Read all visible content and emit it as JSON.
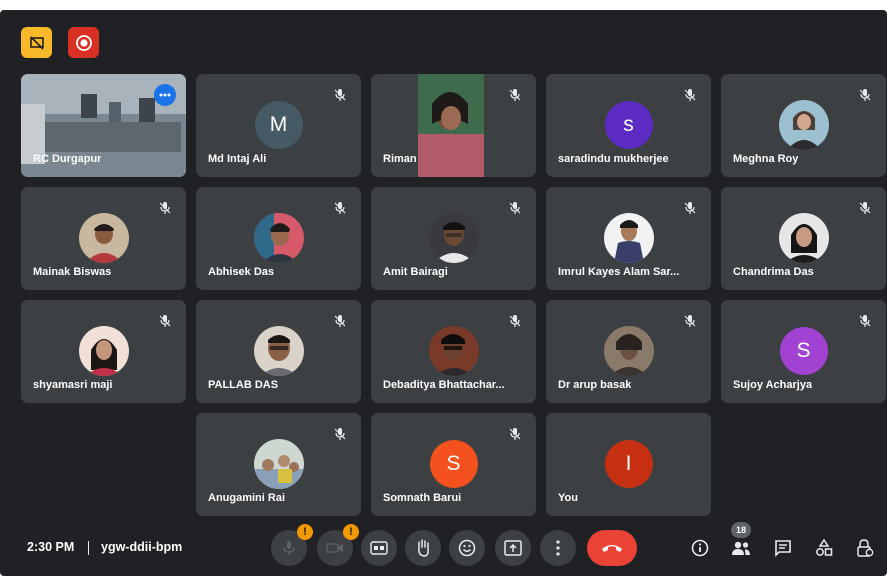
{
  "top_icons": [
    {
      "name": "presentation-off-icon",
      "color": "#f7b928"
    },
    {
      "name": "record-icon",
      "color": "#d93025"
    }
  ],
  "participants": [
    {
      "name": "RC Durgapur",
      "tile": "video",
      "selected": true
    },
    {
      "name": "Md Intaj Ali",
      "tile": "initial",
      "initial": "M",
      "color": "#455a64"
    },
    {
      "name": "Riman",
      "tile": "video"
    },
    {
      "name": "saradindu mukherjee",
      "tile": "initial",
      "initial": "s",
      "color": "#5b2bc4"
    },
    {
      "name": "Meghna Roy",
      "tile": "photo"
    },
    {
      "name": "Mainak Biswas",
      "tile": "photo"
    },
    {
      "name": "Abhisek Das",
      "tile": "photo"
    },
    {
      "name": "Amit Bairagi",
      "tile": "photo"
    },
    {
      "name": "Imrul Kayes Alam Sar...",
      "tile": "photo"
    },
    {
      "name": "Chandrima Das",
      "tile": "photo"
    },
    {
      "name": "shyamasri maji",
      "tile": "photo"
    },
    {
      "name": "PALLAB DAS",
      "tile": "photo"
    },
    {
      "name": "Debaditya Bhattachar...",
      "tile": "photo"
    },
    {
      "name": "Dr arup basak",
      "tile": "photo"
    },
    {
      "name": "Sujoy Acharjya",
      "tile": "initial",
      "initial": "S",
      "color": "#a142d2"
    },
    {
      "name": "Anugamini Rai",
      "tile": "photo"
    },
    {
      "name": "Somnath Barui",
      "tile": "initial",
      "initial": "S",
      "color": "#f4511e"
    },
    {
      "name": "You",
      "tile": "initial",
      "initial": "I",
      "color": "#c62f12"
    }
  ],
  "bottom_bar": {
    "time": "2:30 PM",
    "meeting_code": "ygw-ddii-bpm",
    "warning_mark": "!",
    "people_count": "18",
    "controls": [
      "microphone-icon",
      "camera-icon",
      "captions-icon",
      "raise-hand-icon",
      "emoji-icon",
      "present-screen-icon",
      "more-options-icon",
      "end-call-icon"
    ],
    "right_controls": [
      "info-icon",
      "people-icon",
      "chat-icon",
      "activities-icon",
      "host-controls-icon"
    ],
    "end_call_color": "#ea4335"
  }
}
